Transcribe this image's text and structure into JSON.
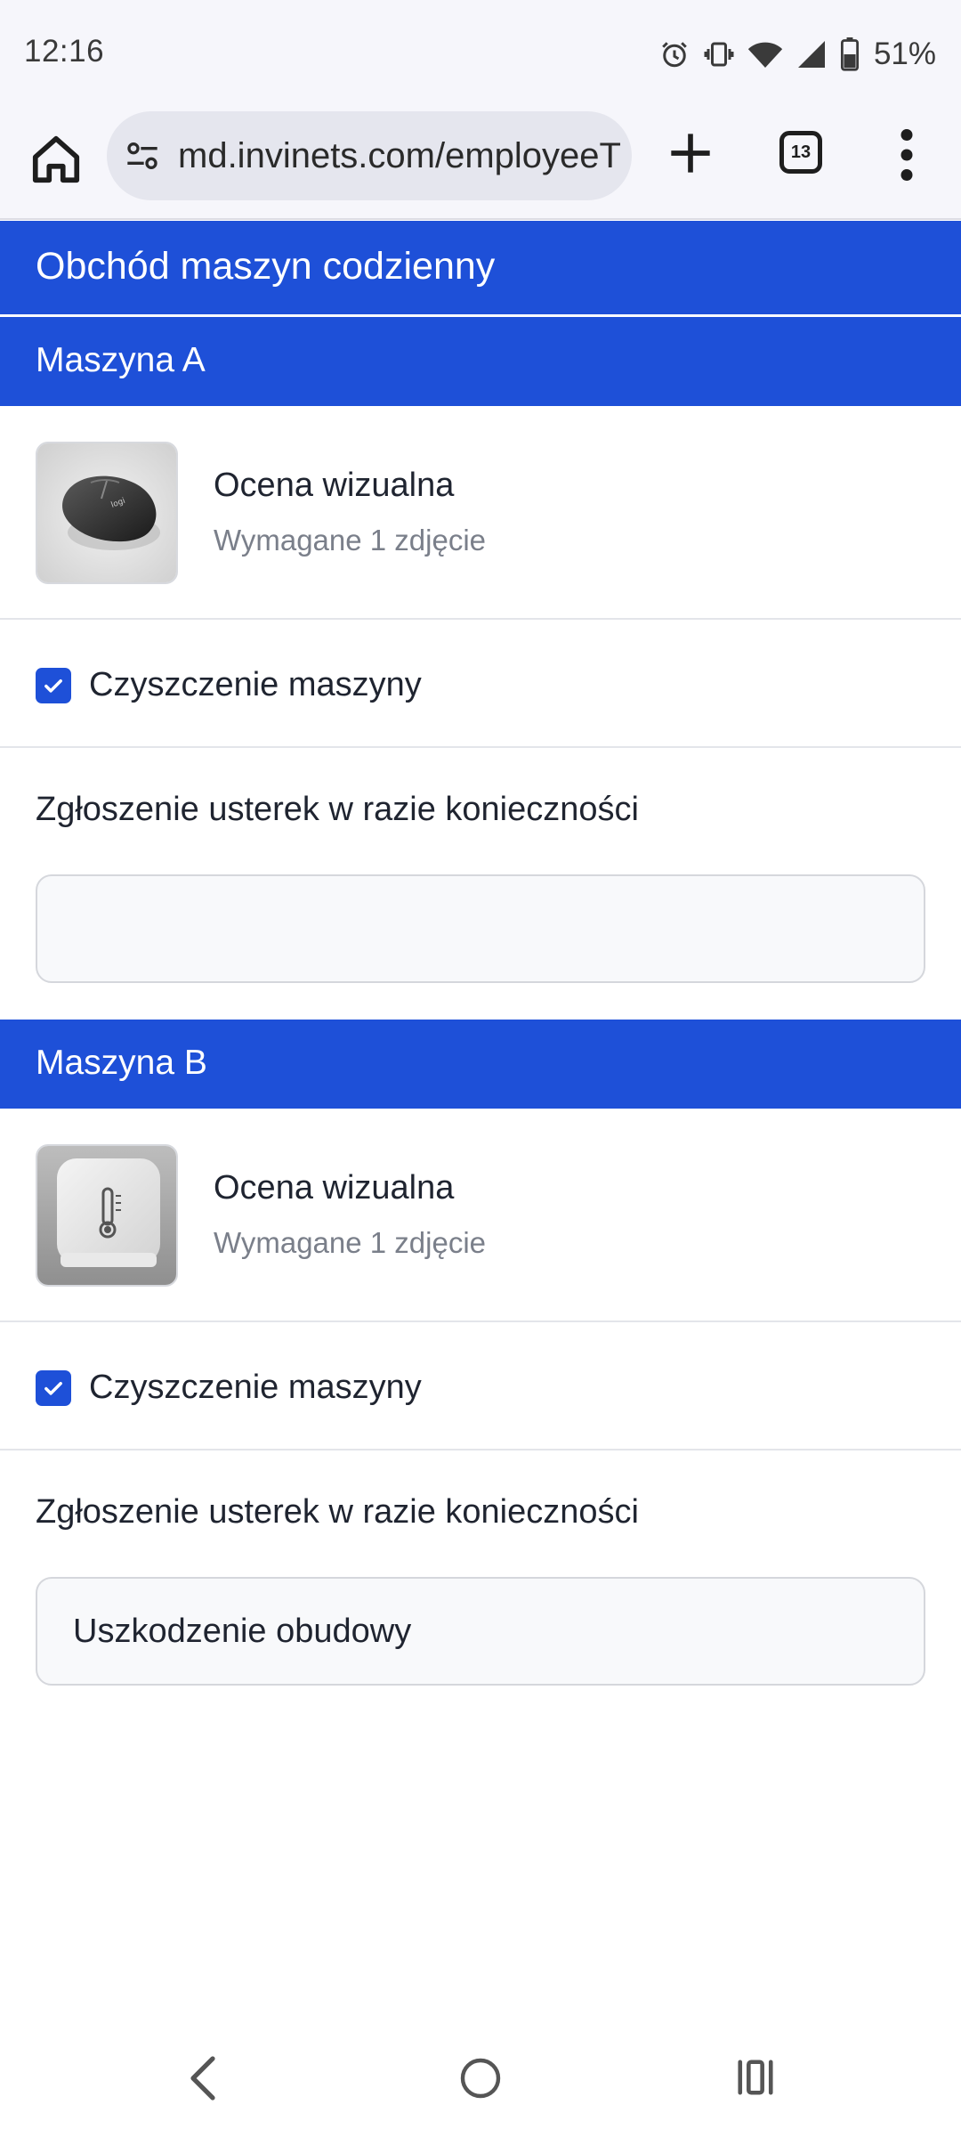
{
  "status_bar": {
    "time": "12:16",
    "battery": "51%",
    "icons": [
      "alarm-icon",
      "vibrate-icon",
      "wifi-icon",
      "signal-icon",
      "battery-icon"
    ]
  },
  "browser": {
    "url": "md.invinets.com/employeeT",
    "tab_count": "13",
    "icons": [
      "home-icon",
      "site-settings-icon",
      "new-tab-icon",
      "tab-switcher-icon",
      "more-menu-icon"
    ]
  },
  "page": {
    "title": "Obchód maszyn codzienny",
    "accent_color": "#1e50d8",
    "sections": [
      {
        "name": "Maszyna A",
        "photo_item": {
          "title": "Ocena wizualna",
          "subtitle": "Wymagane 1 zdjęcie",
          "thumbnail": "computer-mouse-photo"
        },
        "checkbox": {
          "label": "Czyszczenie maszyny",
          "checked": true
        },
        "report": {
          "label": "Zgłoszenie usterek w razie konieczności",
          "value": ""
        }
      },
      {
        "name": "Maszyna B",
        "photo_item": {
          "title": "Ocena wizualna",
          "subtitle": "Wymagane 1 zdjęcie",
          "thumbnail": "thermometer-sensor-photo"
        },
        "checkbox": {
          "label": "Czyszczenie maszyny",
          "checked": true
        },
        "report": {
          "label": "Zgłoszenie usterek w razie konieczności",
          "value": "Uszkodzenie obudowy"
        }
      }
    ]
  },
  "nav_bar": {
    "icons": [
      "back-icon",
      "home-circle-icon",
      "recents-icon"
    ]
  }
}
